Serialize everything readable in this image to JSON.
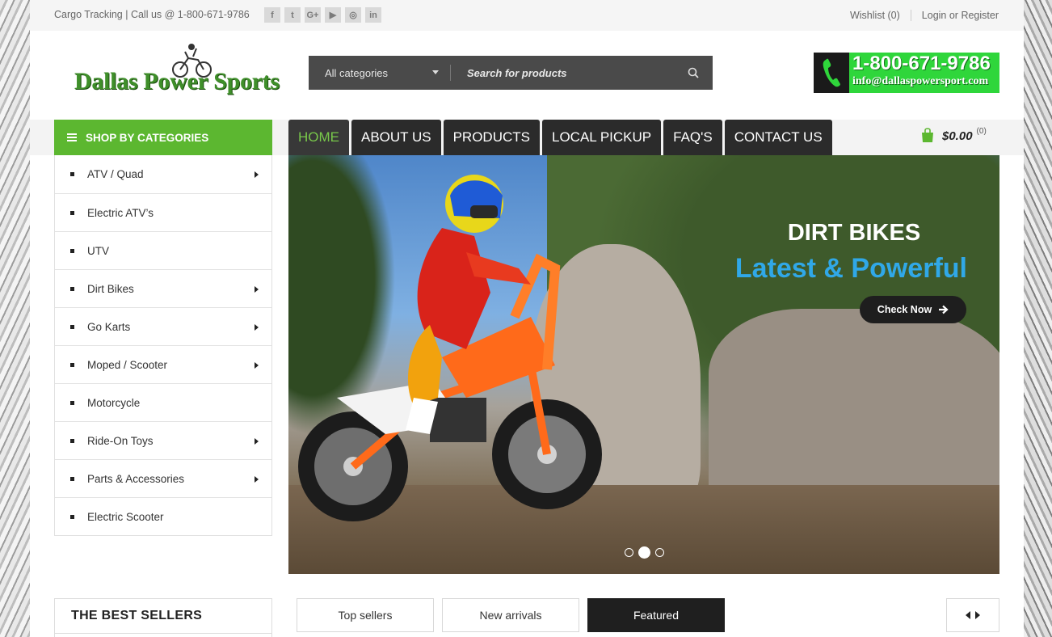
{
  "topbar": {
    "tracking": "Cargo Tracking | Call us @ 1-800-671-9786",
    "social": [
      "f",
      "t",
      "G+",
      "▶",
      "◎",
      "in"
    ],
    "wishlist": "Wishlist (0)",
    "login": "Login or Register"
  },
  "header": {
    "logo_text": "Dallas Power Sports",
    "search": {
      "category": "All categories",
      "placeholder": "Search for products"
    },
    "phone": "1-800-671-9786",
    "email": "info@dallaspowersport.com"
  },
  "categories": {
    "title": "SHOP BY CATEGORIES",
    "items": [
      {
        "label": "ATV / Quad",
        "has_sub": true
      },
      {
        "label": "Electric ATV’s",
        "has_sub": false
      },
      {
        "label": "UTV",
        "has_sub": false
      },
      {
        "label": "Dirt Bikes",
        "has_sub": true
      },
      {
        "label": "Go Karts",
        "has_sub": true
      },
      {
        "label": "Moped / Scooter",
        "has_sub": true
      },
      {
        "label": "Motorcycle",
        "has_sub": false
      },
      {
        "label": "Ride-On Toys",
        "has_sub": true
      },
      {
        "label": "Parts & Accessories",
        "has_sub": true
      },
      {
        "label": "Electric Scooter",
        "has_sub": false
      }
    ]
  },
  "nav": {
    "items": [
      "HOME",
      "ABOUT US",
      "PRODUCTS",
      "LOCAL PICKUP",
      "FAQ'S",
      "CONTACT US"
    ],
    "active_index": 0
  },
  "cart": {
    "amount": "$0.00",
    "count": "(0)"
  },
  "slider": {
    "title": "DIRT BIKES",
    "subtitle": "Latest & Powerful",
    "button": "Check Now",
    "slide_count": 3,
    "active_slide": 2
  },
  "bestsellers": {
    "title": "THE BEST SELLERS"
  },
  "product_tabs": {
    "items": [
      "Top sellers",
      "New arrivals",
      "Featured"
    ],
    "active_index": 2
  },
  "colors": {
    "accent_green": "#5cb730",
    "nav_dark": "#2b2b2b",
    "slide_blue": "#30a8e8",
    "phone_green": "#2fd63b"
  }
}
